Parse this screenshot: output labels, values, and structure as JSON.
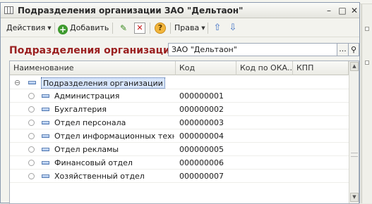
{
  "window": {
    "title": "Подразделения организации ЗАО \"Дельтаон\"",
    "minimize": "–",
    "maximize": "□",
    "close": "✕"
  },
  "toolbar": {
    "actions_label": "Действия",
    "add_label": "Добавить",
    "rights_label": "Права",
    "add_icon": "+",
    "edit_icon": "✎",
    "delete_icon": "✕",
    "help_icon": "?",
    "up_icon": "⇧",
    "down_icon": "⇩"
  },
  "form": {
    "heading": "Подразделения организации",
    "org_value": "ЗАО \"Дельтаон\"",
    "dots": "...",
    "search_icon": "⚲"
  },
  "table": {
    "columns": [
      "Наименование",
      "Код",
      "Код по ОКА...",
      "КПП"
    ],
    "root": {
      "name": "Подразделения организации",
      "expand": "⊖"
    },
    "rows": [
      {
        "name": "Администрация",
        "code": "000000001"
      },
      {
        "name": "Бухгалтерия",
        "code": "000000002"
      },
      {
        "name": "Отдел персонала",
        "code": "000000003"
      },
      {
        "name": "Отдел информационных техно...",
        "code": "000000004"
      },
      {
        "name": "Отдел рекламы",
        "code": "000000005"
      },
      {
        "name": "Финансовый отдел",
        "code": "000000006"
      },
      {
        "name": "Хозяйственный отдел",
        "code": "000000007"
      }
    ]
  },
  "scroll": {
    "up": "▲",
    "down": "▼"
  }
}
